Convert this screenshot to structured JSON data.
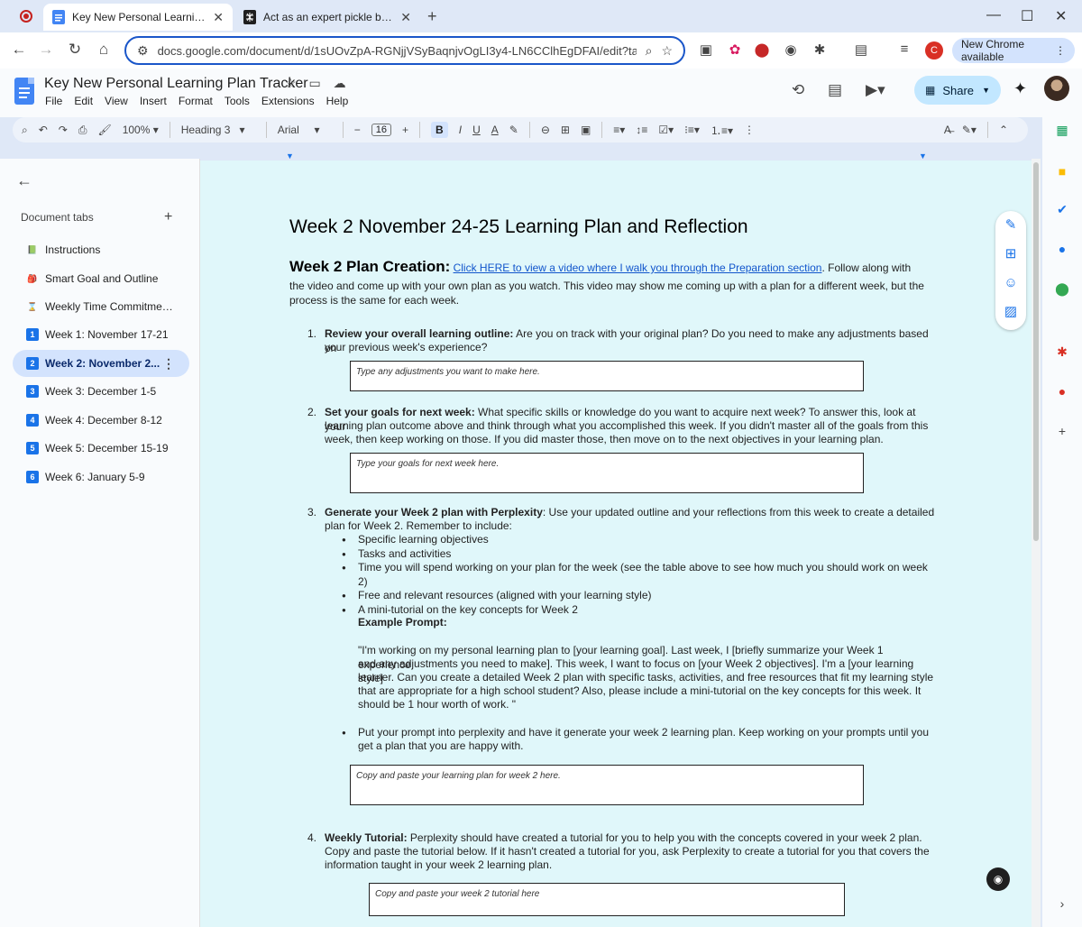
{
  "browser": {
    "tabs": [
      {
        "title": "Key New Personal Learning Plan Tracker",
        "active": true
      },
      {
        "title": "Act as an expert pickle ball coach",
        "active": false
      }
    ],
    "url": "docs.google.com/document/d/1sUOvZpA-RGNjjVSyBaqnjvOgLI3y4-LN6CClhEgDFAI/edit?tab=...",
    "update_label": "New Chrome available",
    "profile_initial": "C"
  },
  "docs": {
    "title": "Key New Personal Learning Plan Tracker",
    "menu": [
      "File",
      "Edit",
      "View",
      "Insert",
      "Format",
      "Tools",
      "Extensions",
      "Help"
    ],
    "share_label": "Share"
  },
  "toolbar": {
    "zoom": "100%",
    "style": "Heading 3",
    "font": "Arial",
    "font_size": "16",
    "bold": "B",
    "italic": "I",
    "underline": "U",
    "text_color": "A"
  },
  "sidebar": {
    "heading": "Document tabs",
    "tabs": [
      {
        "label": "Instructions",
        "icon": "📗"
      },
      {
        "label": "Smart Goal and Outline",
        "icon": "🎒"
      },
      {
        "label": "Weekly Time Commitment ...",
        "icon": "⌛"
      },
      {
        "label": "Week 1: November 17-21",
        "icon": "1"
      },
      {
        "label": "Week 2: November 2...",
        "icon": "2",
        "active": true
      },
      {
        "label": "Week 3: December 1-5",
        "icon": "3"
      },
      {
        "label": "Week 4: December 8-12",
        "icon": "4"
      },
      {
        "label": "Week 5: December 15-19",
        "icon": "5"
      },
      {
        "label": "Week 6: January 5-9",
        "icon": "6"
      }
    ]
  },
  "document": {
    "heading": "Week 2 November 24-25 Learning Plan and Reflection",
    "plan_heading": "Week 2 Plan Creation:",
    "plan_link": "Click HERE to view a video where I walk you through the Preparation section",
    "plan_text_1": ".  Follow along with",
    "plan_text_2": "the video and come up with your own plan as you watch. This video may show me coming up with a plan for a different week, but the",
    "plan_text_3": "process is the same for each week.",
    "items": [
      {
        "num": "1.",
        "bold": "Review your overall learning outline:",
        "line1": " Are you on track with your original plan? Do you need to make any adjustments based on",
        "line2": "your previous week's experience?",
        "box": "Type any adjustments you want to make here."
      },
      {
        "num": "2.",
        "bold": "Set your goals for next week:",
        "line1": " What specific skills or knowledge do you want to acquire next week?  To answer this, look at your",
        "line2": "learning plan outcome above and think through what you accomplished this week.  If you didn't master all of the goals from this",
        "line3": "week, then keep working on those.  If you did master those, then move on to the next objectives in your learning plan.",
        "box": "Type your goals for next week here."
      },
      {
        "num": "3.",
        "bold": "Generate your Week 2 plan with Perplexity",
        "line1": ": Use your updated outline and your reflections from this week to create a detailed",
        "line2": "plan for Week 2. Remember to include:",
        "bullets": [
          "Specific learning objectives",
          "Tasks and activities",
          "Time you will spend working on your plan for the week (see the table above to see how much you should work on week 2)",
          "Free and relevant resources (aligned with your learning style)",
          "A mini-tutorial on the key concepts for Week 2"
        ],
        "prompt_heading": "Example Prompt:",
        "prompt_lines": [
          "\"I'm working on my personal learning plan to [your learning goal]. Last week, I [briefly summarize your Week 1 experience",
          "and any adjustments you need to make]. This week, I want to focus on [your Week 2 objectives]. I'm a [your learning style]",
          "learner. Can you create a detailed Week 2 plan with specific tasks, activities, and free resources that fit my learning style",
          "that are appropriate for a high school student? Also, please include a mini-tutorial on the key concepts for this week.  It",
          "should be 1 hour worth of work. \""
        ],
        "after_bullet_1": "Put your prompt into perplexity and have it generate your week 2 learning plan.  Keep working on your prompts until you",
        "after_bullet_2": "get a plan that you are happy with.",
        "box": "Copy and paste your learning plan for week 2 here."
      },
      {
        "num": "4.",
        "bold": "Weekly Tutorial:",
        "line1": " Perplexity should have created a tutorial for you to help you with the concepts covered in your week 2 plan.",
        "line2": "Copy and paste the tutorial below.  If it hasn't created a tutorial for you, ask Perplexity to create a tutorial for you that covers the",
        "line3": "information taught in your week 2 learning plan.",
        "box": "Copy and paste your week 2 tutorial here"
      }
    ]
  },
  "colors": {
    "page_bg": "#e0f7fa",
    "accent": "#1a73e8",
    "share_bg": "#c2e7ff",
    "active_tab_bg": "#d3e3fd"
  }
}
